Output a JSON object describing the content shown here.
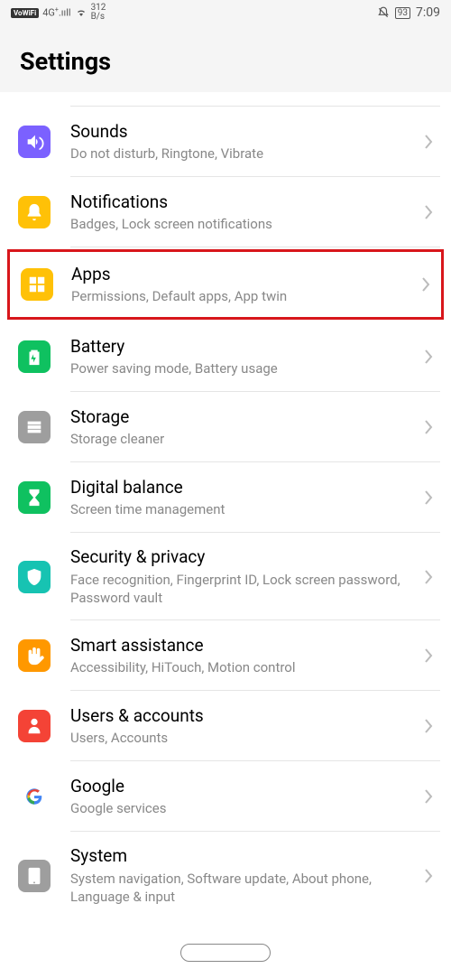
{
  "status": {
    "vowifi": "VoWiFi",
    "network": "4G",
    "speed_top": "312",
    "speed_bottom": "B/s",
    "battery": "93",
    "time": "7:09"
  },
  "header": {
    "title": "Settings"
  },
  "items": [
    {
      "title": "Sounds",
      "sub": "Do not disturb, Ringtone, Vibrate",
      "icon": "sound",
      "bg": "bg-purple",
      "highlighted": false
    },
    {
      "title": "Notifications",
      "sub": "Badges, Lock screen notifications",
      "icon": "bell",
      "bg": "bg-yellow",
      "highlighted": false
    },
    {
      "title": "Apps",
      "sub": "Permissions, Default apps, App twin",
      "icon": "apps",
      "bg": "bg-yellow",
      "highlighted": true
    },
    {
      "title": "Battery",
      "sub": "Power saving mode, Battery usage",
      "icon": "battery",
      "bg": "bg-green",
      "highlighted": false
    },
    {
      "title": "Storage",
      "sub": "Storage cleaner",
      "icon": "storage",
      "bg": "bg-gray",
      "highlighted": false
    },
    {
      "title": "Digital balance",
      "sub": "Screen time management",
      "icon": "hourglass",
      "bg": "bg-green",
      "highlighted": false
    },
    {
      "title": "Security & privacy",
      "sub": "Face recognition, Fingerprint ID, Lock screen password, Password vault",
      "icon": "shield",
      "bg": "bg-teal",
      "highlighted": false
    },
    {
      "title": "Smart assistance",
      "sub": "Accessibility, HiTouch, Motion control",
      "icon": "hand",
      "bg": "bg-orange",
      "highlighted": false
    },
    {
      "title": "Users & accounts",
      "sub": "Users, Accounts",
      "icon": "user",
      "bg": "bg-red",
      "highlighted": false
    },
    {
      "title": "Google",
      "sub": "Google services",
      "icon": "google",
      "bg": "bg-white",
      "highlighted": false
    },
    {
      "title": "System",
      "sub": "System navigation, Software update, About phone, Language & input",
      "icon": "phone",
      "bg": "bg-gray",
      "highlighted": false
    }
  ]
}
